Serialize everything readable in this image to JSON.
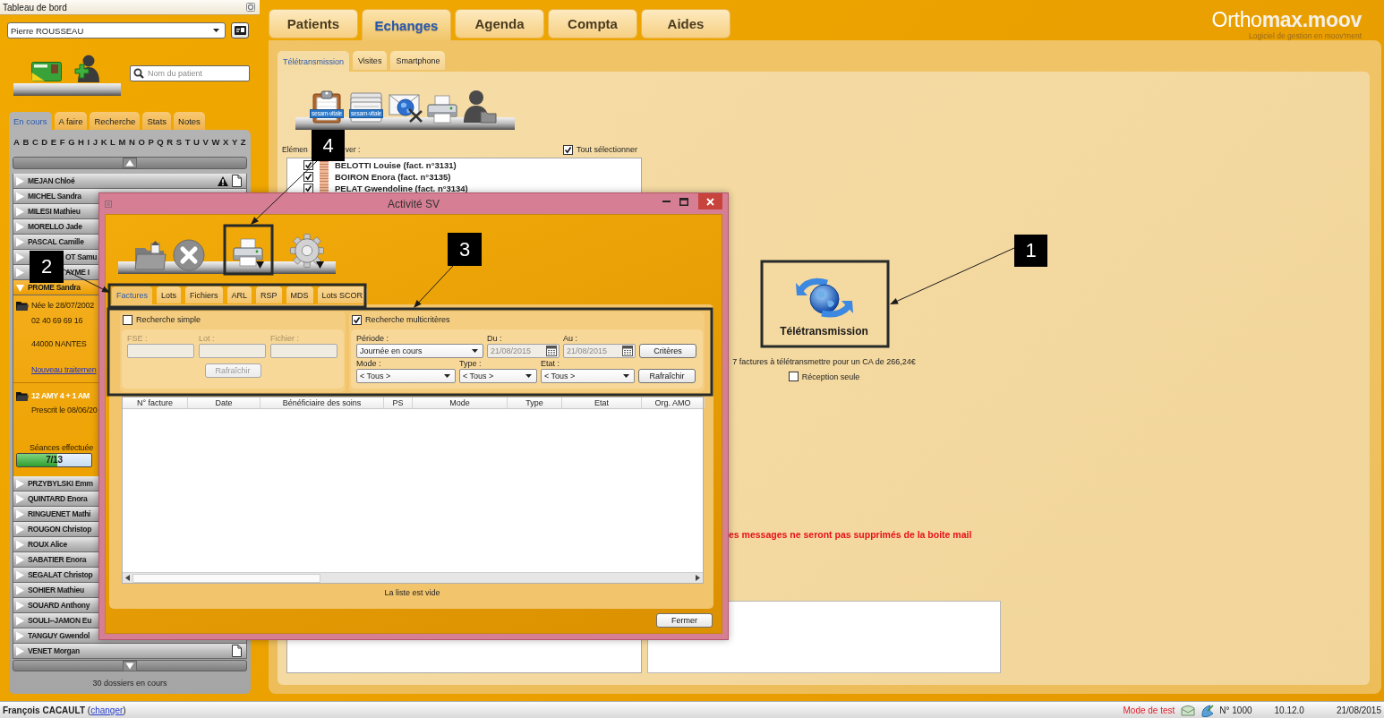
{
  "sidebar": {
    "title": "Tableau de bord",
    "user_select": {
      "value": "Pierre ROUSSEAU"
    },
    "search": {
      "placeholder": "Nom du patient"
    },
    "tabs": [
      {
        "label": "En cours",
        "selected": true
      },
      {
        "label": "A faire",
        "selected": false
      },
      {
        "label": "Recherche",
        "selected": false
      },
      {
        "label": "Stats",
        "selected": false
      },
      {
        "label": "Notes",
        "selected": false
      }
    ],
    "alphabet": [
      "A",
      "B",
      "C",
      "D",
      "E",
      "F",
      "G",
      "H",
      "I",
      "J",
      "K",
      "L",
      "M",
      "N",
      "O",
      "P",
      "Q",
      "R",
      "S",
      "T",
      "U",
      "V",
      "W",
      "X",
      "Y",
      "Z"
    ],
    "patients": [
      {
        "name": "MEJAN Chloé",
        "expanded": false,
        "covered": false,
        "warning": true,
        "document": true
      },
      {
        "name": "MICHEL Sandra",
        "expanded": false,
        "covered": false,
        "warning": false,
        "document": false
      },
      {
        "name": "MILESI Mathieu",
        "expanded": false,
        "covered": false,
        "warning": false,
        "document": false
      },
      {
        "name": "MORELLO Jade",
        "expanded": false,
        "covered": false,
        "warning": false,
        "document": false
      },
      {
        "name": "PASCAL Camille",
        "expanded": false,
        "covered": false,
        "warning": false,
        "document": false
      },
      {
        "name": "OT Samu",
        "expanded": false,
        "covered": true,
        "warning": false,
        "document": false
      },
      {
        "name": "AYME I",
        "expanded": false,
        "covered": true,
        "warning": false,
        "document": false
      },
      {
        "name": "PROME Sandra",
        "expanded": true,
        "covered": false,
        "warning": false,
        "document": false,
        "details": {
          "birth": "Née le 28/07/2002",
          "phone": "02 40 69 69 16",
          "city": "44000 NANTES",
          "new_treatment_link": "Nouveau traitemen",
          "treatment": {
            "title": "12 AMY 4 + 1 AM",
            "prescribed": "Prescrit le 08/06/20",
            "sessions_label": "Séances effectuée",
            "sessions": {
              "level": 0.54,
              "reading": "7/13"
            }
          }
        }
      },
      {
        "name": "PRZYBYLSKI Emm",
        "expanded": false,
        "covered": false,
        "warning": false,
        "document": false
      },
      {
        "name": "QUINTARD Enora",
        "expanded": false,
        "covered": false,
        "warning": false,
        "document": false
      },
      {
        "name": "RINGUENET Mathi",
        "expanded": false,
        "covered": false,
        "warning": false,
        "document": false
      },
      {
        "name": "ROUGON Christop",
        "expanded": false,
        "covered": false,
        "warning": false,
        "document": false
      },
      {
        "name": "ROUX Alice",
        "expanded": false,
        "covered": false,
        "warning": false,
        "document": false
      },
      {
        "name": "SABATIER Enora",
        "expanded": false,
        "covered": false,
        "warning": false,
        "document": false
      },
      {
        "name": "SEGALAT Christop",
        "expanded": false,
        "covered": false,
        "warning": false,
        "document": false
      },
      {
        "name": "SOHIER Mathieu",
        "expanded": false,
        "covered": false,
        "warning": false,
        "document": false
      },
      {
        "name": "SOUARD Anthony",
        "expanded": false,
        "covered": false,
        "warning": false,
        "document": false
      },
      {
        "name": "SOULI--JAMON Eu",
        "expanded": false,
        "covered": false,
        "warning": false,
        "document": false
      },
      {
        "name": "TANGUY Gwendol",
        "expanded": false,
        "covered": false,
        "warning": false,
        "document": false
      },
      {
        "name": "VENET Morgan",
        "expanded": false,
        "covered": false,
        "warning": false,
        "document": true
      }
    ],
    "count": "30 dossiers en cours"
  },
  "main_tabs": [
    {
      "label": "Patients",
      "selected": false
    },
    {
      "label": "Echanges",
      "selected": true
    },
    {
      "label": "Agenda",
      "selected": false
    },
    {
      "label": "Compta",
      "selected": false
    },
    {
      "label": "Aides",
      "selected": false
    }
  ],
  "logo": {
    "text": "Ortho**max.moov**",
    "tagline": "Logiciel de gestion en moov'ment"
  },
  "exchanges": {
    "sub_tabs": [
      {
        "label": "Télétransmission",
        "selected": true
      },
      {
        "label": "Visites",
        "selected": false
      },
      {
        "label": "Smartphone",
        "selected": false
      }
    ],
    "toolbar": [
      {
        "kind": "clipboard",
        "badge": "sesam-vitale"
      },
      {
        "kind": "card",
        "badge": "sesam-vitale"
      },
      {
        "kind": "mail"
      },
      {
        "kind": "printer"
      },
      {
        "kind": "person"
      }
    ],
    "send_list": {
      "label_parts": [
        "Elémen",
        "ver :"
      ],
      "select_all": {
        "label": "Tout sélectionner",
        "checked": true
      },
      "items": [
        {
          "label": "BELOTTI Louise (fact. n°3131)",
          "checked": true
        },
        {
          "label": "BOIRON Enora (fact. n°3135)",
          "checked": true
        },
        {
          "label": "PELAT Gwendoline (fact. n°3134)",
          "checked": true
        }
      ]
    },
    "teletransmission": {
      "label": "Télétransmission",
      "summary": "7 factures à télétransmettre pour un CA de 266,24€",
      "receive_only": {
        "label": "Réception seule",
        "checked": false
      }
    },
    "warning": "es messages ne seront pas supprimés de la boite mail"
  },
  "dialog": {
    "title": "Activité SV",
    "toolbar": [
      {
        "kind": "folder-upload",
        "dropdown": false
      },
      {
        "kind": "cancel",
        "dropdown": false
      },
      {
        "kind": "printer",
        "dropdown": true
      },
      {
        "kind": "gear",
        "dropdown": true
      }
    ],
    "tabs": [
      {
        "label": "Factures",
        "selected": true
      },
      {
        "label": "Lots",
        "selected": false
      },
      {
        "label": "Fichiers",
        "selected": false
      },
      {
        "label": "ARL",
        "selected": false
      },
      {
        "label": "RSP",
        "selected": false
      },
      {
        "label": "MDS",
        "selected": false
      },
      {
        "label": "Lots SCOR",
        "selected": false
      }
    ],
    "simple_search": {
      "label": "Recherche simple",
      "checked": false,
      "fields": [
        {
          "label": "FSE :"
        },
        {
          "label": "Lot :"
        },
        {
          "label": "Fichier :"
        }
      ],
      "refresh_button": "Rafraîchir"
    },
    "multi_search": {
      "label": "Recherche multicritères",
      "checked": true,
      "period": {
        "label": "Période :",
        "value": "Journée en cours"
      },
      "from": {
        "label": "Du :",
        "value": "21/08/2015",
        "disabled": true
      },
      "to": {
        "label": "Au :",
        "value": "21/08/2015",
        "disabled": true
      },
      "criteria_button": "Critères",
      "mode": {
        "label": "Mode :",
        "value": "< Tous >"
      },
      "type": {
        "label": "Type :",
        "value": "< Tous >"
      },
      "state": {
        "label": "Etat :",
        "value": "< Tous >"
      },
      "refresh_button": "Rafraîchir"
    },
    "table": {
      "columns": [
        "N° facture",
        "Date",
        "Bénéficiaire des soins",
        "PS",
        "Mode",
        "Type",
        "Etat",
        "Org. AMO"
      ],
      "empty_text": "La liste est vide"
    },
    "close_button": "Fermer"
  },
  "annotations": [
    {
      "label": "1"
    },
    {
      "label": "2"
    },
    {
      "label": "3"
    },
    {
      "label": "4"
    }
  ],
  "status_bar": {
    "user": "François CACAULT",
    "link_open": " (",
    "change_link": "changer",
    "link_close": ")",
    "mode": "Mode de test",
    "number": "N° 1000",
    "version": "10.12.0",
    "date": "21/08/2015"
  }
}
